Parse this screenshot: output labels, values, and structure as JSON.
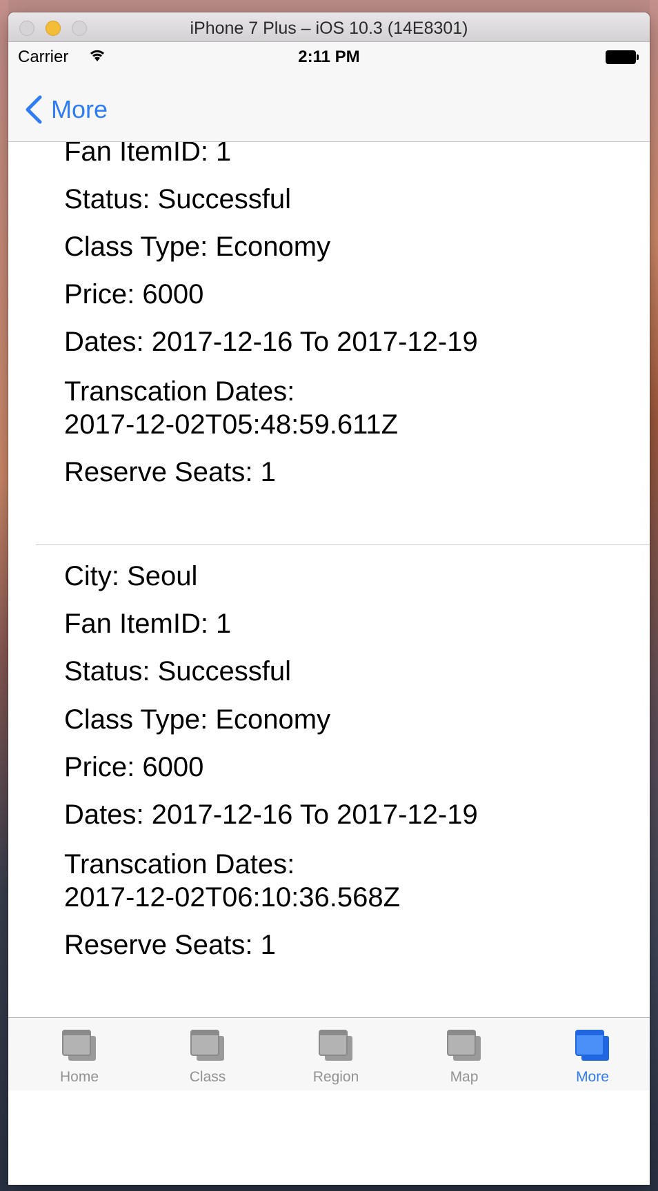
{
  "window": {
    "title": "iPhone 7 Plus – iOS 10.3 (14E8301)"
  },
  "status_bar": {
    "carrier": "Carrier",
    "time": "2:11 PM"
  },
  "nav": {
    "back_label": "More"
  },
  "records": [
    {
      "fan_item": "Fan ItemID: 1",
      "status": "Status: Successful",
      "class_type": "Class Type: Economy",
      "price": "Price: 6000",
      "dates": "Dates: 2017-12-16 To 2017-12-19",
      "transaction_label": "Transcation Dates:",
      "transaction_value": "2017-12-02T05:48:59.611Z",
      "reserve_seats": "Reserve Seats: 1"
    },
    {
      "city": "City: Seoul",
      "fan_item": "Fan ItemID: 1",
      "status": "Status: Successful",
      "class_type": "Class Type: Economy",
      "price": "Price: 6000",
      "dates": "Dates: 2017-12-16 To 2017-12-19",
      "transaction_label": "Transcation Dates:",
      "transaction_value": "2017-12-02T06:10:36.568Z",
      "reserve_seats": "Reserve Seats: 1"
    }
  ],
  "tab_bar": {
    "tabs": [
      {
        "label": "Home",
        "icon": "window-stack-icon",
        "active": false
      },
      {
        "label": "Class",
        "icon": "window-stack-icon",
        "active": false
      },
      {
        "label": "Region",
        "icon": "window-stack-icon",
        "active": false
      },
      {
        "label": "Map",
        "icon": "window-stack-icon",
        "active": false
      },
      {
        "label": "More",
        "icon": "window-stack-icon",
        "active": true
      }
    ]
  },
  "colors": {
    "accent": "#2f7cf6",
    "tab_inactive": "#929292",
    "bar_background": "#f7f7f7",
    "traffic_yellow": "#f3bd37"
  }
}
